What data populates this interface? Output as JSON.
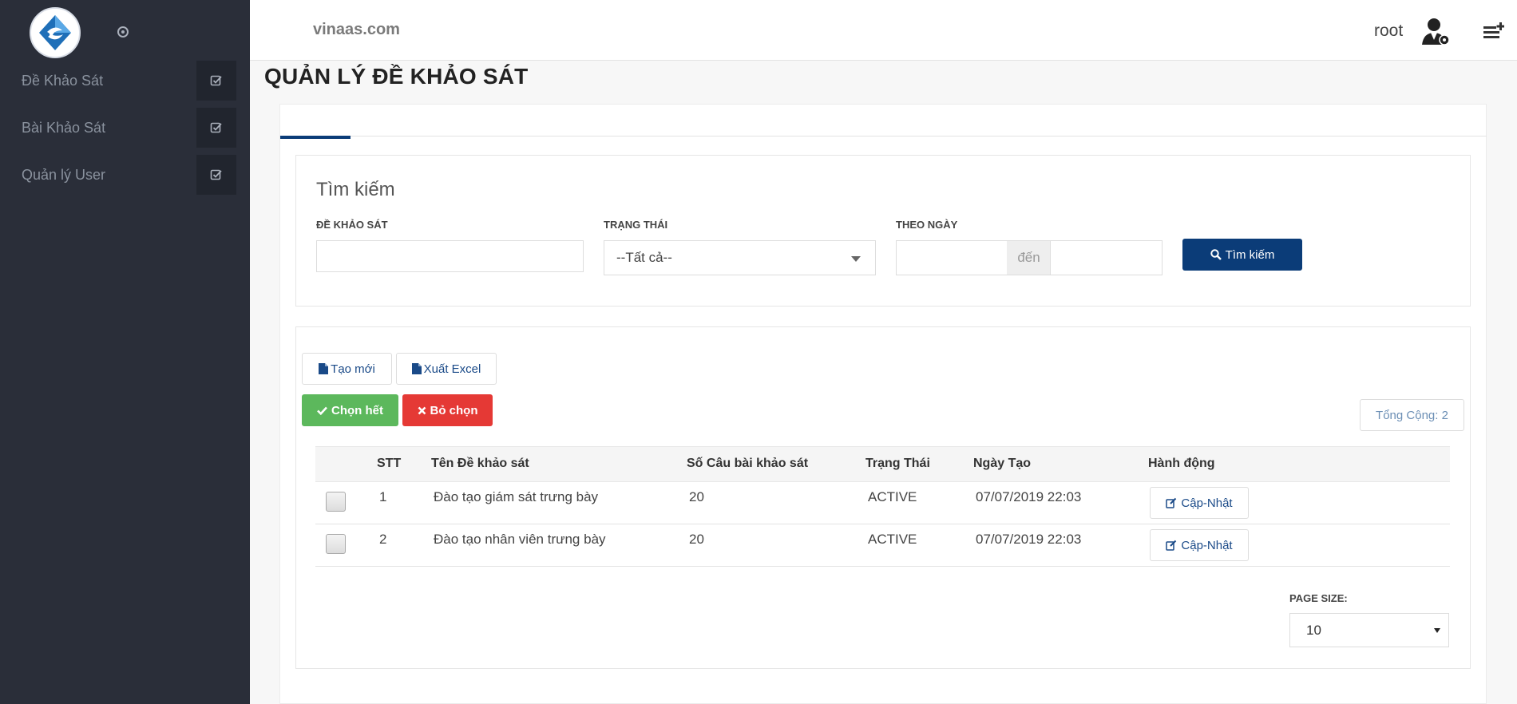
{
  "topbar": {
    "domain": "vinaas.com",
    "username": "root"
  },
  "sidebar": {
    "items": [
      {
        "label": "Đề Khảo Sát"
      },
      {
        "label": "Bài Khảo Sát"
      },
      {
        "label": "Quản lý User"
      }
    ]
  },
  "page": {
    "title": "QUẢN LÝ ĐỀ KHẢO SÁT"
  },
  "search": {
    "title": "Tìm kiếm",
    "label_de": "ĐỀ KHẢO SÁT",
    "label_status": "TRẠNG THÁI",
    "label_date": "THEO NGÀY",
    "de_value": "",
    "status_value": "--Tất cả--",
    "date_from": "",
    "date_sep": "đến",
    "date_to": "",
    "button": "Tìm kiếm"
  },
  "actions": {
    "create": "Tạo mới",
    "export": "Xuất Excel",
    "select_all": "Chọn hết",
    "deselect": "Bỏ chọn",
    "total": "Tổng Cộng: 2"
  },
  "table": {
    "headers": {
      "stt": "STT",
      "name": "Tên Đề khảo sát",
      "count": "Số Câu bài khảo sát",
      "status": "Trạng Thái",
      "date": "Ngày Tạo",
      "action": "Hành động"
    },
    "rows": [
      {
        "stt": "1",
        "name": "Đào tạo giám sát trưng bày",
        "count": "20",
        "status": "ACTIVE",
        "date": "07/07/2019 22:03",
        "action": "Cập-Nhật"
      },
      {
        "stt": "2",
        "name": "Đào tạo nhân viên trưng bày",
        "count": "20",
        "status": "ACTIVE",
        "date": "07/07/2019 22:03",
        "action": "Cập-Nhật"
      }
    ]
  },
  "pagination": {
    "label": "PAGE SIZE:",
    "value": "10"
  },
  "colors": {
    "sidebar_bg": "#2a2e39",
    "primary": "#0b3c78",
    "success": "#5cb85c",
    "danger": "#e53935"
  }
}
